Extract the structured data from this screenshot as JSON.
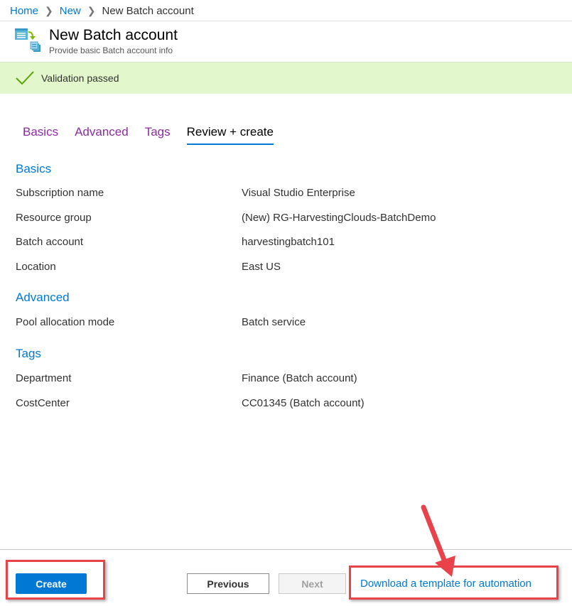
{
  "breadcrumb": {
    "items": [
      "Home",
      "New"
    ],
    "current": "New Batch account"
  },
  "header": {
    "title": "New Batch account",
    "subtitle": "Provide basic Batch account info",
    "icon": "batch-account-icon"
  },
  "validation": {
    "status": "Validation passed",
    "icon": "checkmark-icon",
    "color": "#e3f7cc"
  },
  "tabs": [
    {
      "label": "Basics",
      "active": false
    },
    {
      "label": "Advanced",
      "active": false
    },
    {
      "label": "Tags",
      "active": false
    },
    {
      "label": "Review + create",
      "active": true
    }
  ],
  "sections": {
    "basics": {
      "title": "Basics",
      "rows": [
        {
          "label": "Subscription name",
          "value": "Visual Studio Enterprise"
        },
        {
          "label": "Resource group",
          "value": "(New) RG-HarvestingClouds-BatchDemo"
        },
        {
          "label": "Batch account",
          "value": "harvestingbatch101"
        },
        {
          "label": "Location",
          "value": "East US"
        }
      ]
    },
    "advanced": {
      "title": "Advanced",
      "rows": [
        {
          "label": "Pool allocation mode",
          "value": "Batch service"
        }
      ]
    },
    "tags": {
      "title": "Tags",
      "rows": [
        {
          "label": "Department",
          "value": "Finance (Batch account)"
        },
        {
          "label": "CostCenter",
          "value": "CC01345 (Batch account)"
        }
      ]
    }
  },
  "footer": {
    "create_label": "Create",
    "previous_label": "Previous",
    "next_label": "Next",
    "download_label": "Download a template for automation"
  },
  "colors": {
    "accent": "#0078d4",
    "tab_link": "#8b2c9f",
    "highlight": "#e8434a"
  }
}
